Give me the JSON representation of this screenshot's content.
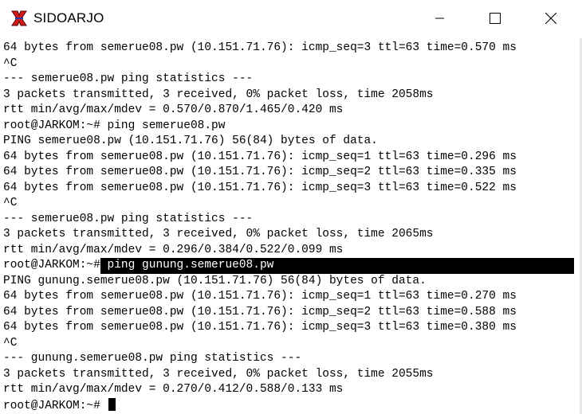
{
  "window": {
    "title": "SIDOARJO",
    "icons": {
      "app": "putty-app-icon",
      "minimize": "minimize-icon",
      "maximize": "maximize-icon",
      "close": "close-icon"
    }
  },
  "terminal": {
    "lines": [
      "64 bytes from semerue08.pw (10.151.71.76): icmp_seq=3 ttl=63 time=0.570 ms",
      "^C",
      "--- semerue08.pw ping statistics ---",
      "3 packets transmitted, 3 received, 0% packet loss, time 2058ms",
      "rtt min/avg/max/mdev = 0.570/0.870/1.465/0.420 ms",
      "root@JARKOM:~# ping semerue08.pw",
      "PING semerue08.pw (10.151.71.76) 56(84) bytes of data.",
      "64 bytes from semerue08.pw (10.151.71.76): icmp_seq=1 ttl=63 time=0.296 ms",
      "64 bytes from semerue08.pw (10.151.71.76): icmp_seq=2 ttl=63 time=0.335 ms",
      "64 bytes from semerue08.pw (10.151.71.76): icmp_seq=3 ttl=63 time=0.522 ms",
      "^C",
      "--- semerue08.pw ping statistics ---",
      "3 packets transmitted, 3 received, 0% packet loss, time 2065ms",
      "rtt min/avg/max/mdev = 0.296/0.384/0.522/0.099 ms"
    ],
    "highlighted_prompt": "root@JARKOM:~#",
    "highlighted_command": " ping gunung.semerue08.pw",
    "lines_after": [
      "PING gunung.semerue08.pw (10.151.71.76) 56(84) bytes of data.",
      "64 bytes from semerue08.pw (10.151.71.76): icmp_seq=1 ttl=63 time=0.270 ms",
      "64 bytes from semerue08.pw (10.151.71.76): icmp_seq=2 ttl=63 time=0.588 ms",
      "64 bytes from semerue08.pw (10.151.71.76): icmp_seq=3 ttl=63 time=0.380 ms",
      "^C",
      "--- gunung.semerue08.pw ping statistics ---",
      "3 packets transmitted, 3 received, 0% packet loss, time 2055ms",
      "rtt min/avg/max/mdev = 0.270/0.412/0.588/0.133 ms"
    ],
    "final_prompt": "root@JARKOM:~# "
  }
}
